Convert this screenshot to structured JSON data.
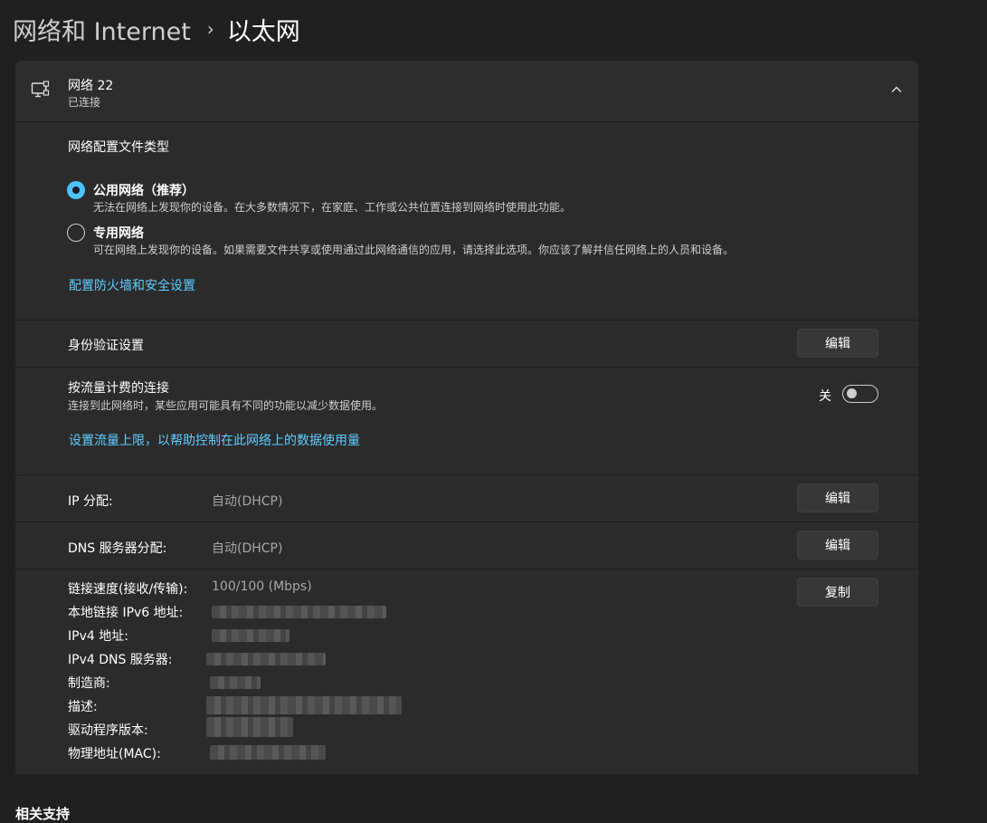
{
  "breadcrumb": {
    "parent": "网络和 Internet",
    "separator": "›",
    "current": "以太网"
  },
  "network": {
    "name": "网络 22",
    "status": "已连接"
  },
  "profile": {
    "title": "网络配置文件类型",
    "options": [
      {
        "label": "公用网络（推荐）",
        "description": "无法在网络上发现你的设备。在大多数情况下，在家庭、工作或公共位置连接到网络时使用此功能。",
        "selected": true
      },
      {
        "label": "专用网络",
        "description": "可在网络上发现你的设备。如果需要文件共享或使用通过此网络通信的应用，请选择此选项。你应该了解并信任网络上的人员和设备。",
        "selected": false
      }
    ],
    "firewall_link": "配置防火墙和安全设置"
  },
  "auth": {
    "label": "身份验证设置",
    "button": "编辑"
  },
  "metered": {
    "label": "按流量计费的连接",
    "description": "连接到此网络时，某些应用可能具有不同的功能以减少数据使用。",
    "toggle_label": "关",
    "toggle_on": false,
    "limit_link": "设置流量上限，以帮助控制在此网络上的数据使用量"
  },
  "ip": {
    "label": "IP 分配:",
    "value": "自动(DHCP)",
    "button": "编辑"
  },
  "dns": {
    "label": "DNS 服务器分配:",
    "value": "自动(DHCP)",
    "button": "编辑"
  },
  "details": {
    "button": "复制",
    "rows": [
      {
        "label": "链接速度(接收/传输):",
        "value": "100/100 (Mbps)"
      },
      {
        "label": "本地链接 IPv6 地址:",
        "value": ""
      },
      {
        "label": "IPv4 地址:",
        "value": ""
      },
      {
        "label": "IPv4 DNS 服务器:",
        "value": ""
      },
      {
        "label": "制造商:",
        "value": ""
      },
      {
        "label": "描述:",
        "value": ""
      },
      {
        "label": "驱动程序版本:",
        "value": ""
      },
      {
        "label": "物理地址(MAC):",
        "value": ""
      }
    ]
  },
  "related": {
    "title": "相关支持"
  },
  "colors": {
    "accent": "#4cc2ff",
    "link": "#60cdff",
    "background": "#202020",
    "card": "#2b2b2b"
  },
  "icons": [
    "ethernet-monitor-icon",
    "chevron-up-icon"
  ]
}
